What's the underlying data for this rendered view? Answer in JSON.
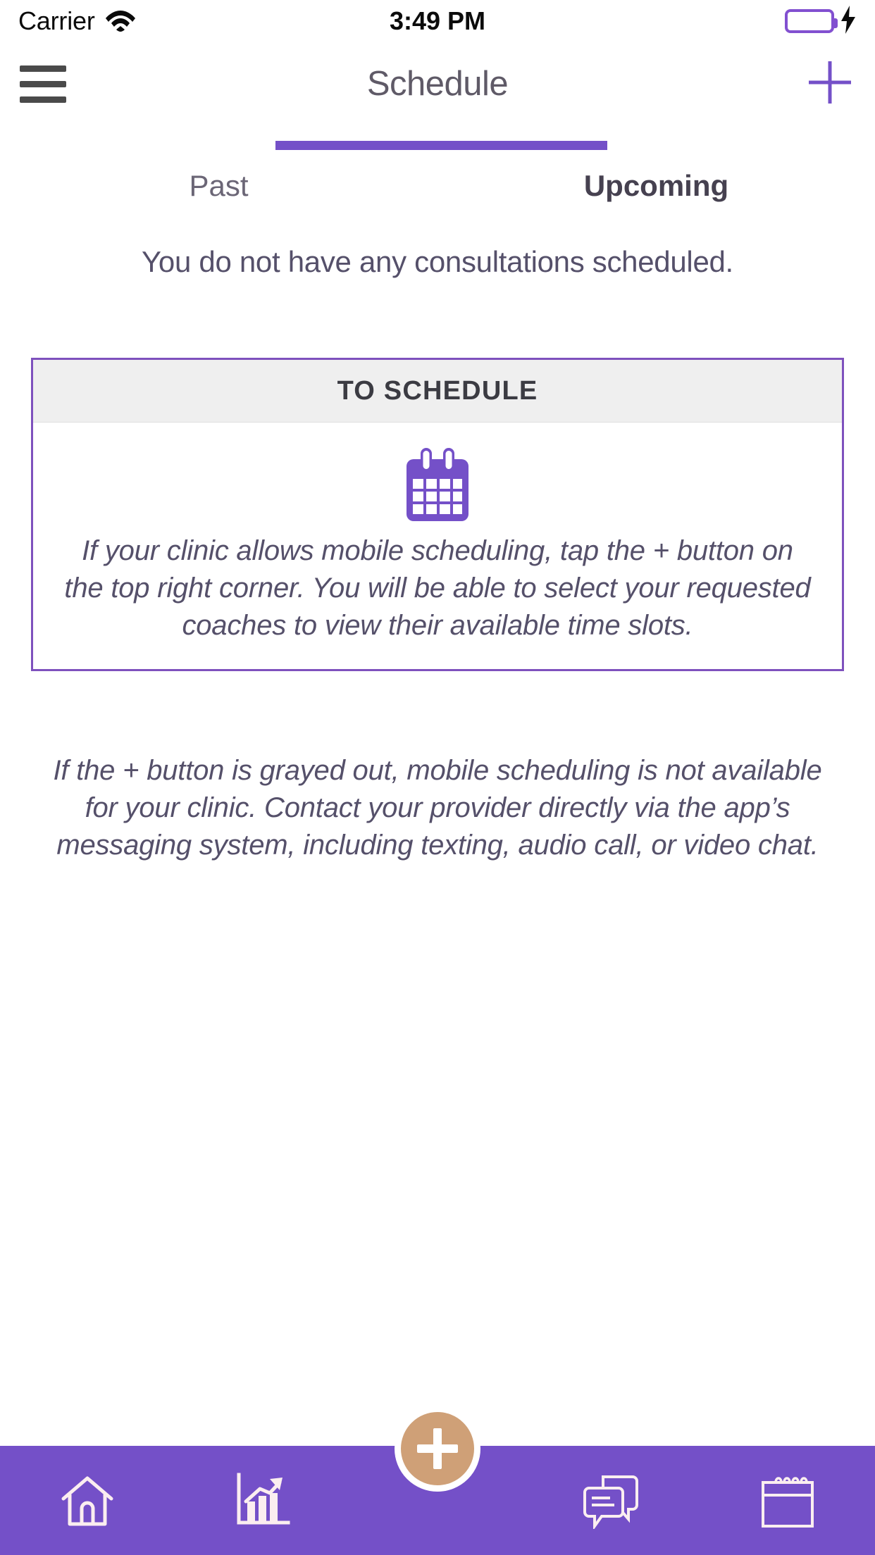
{
  "status_bar": {
    "carrier": "Carrier",
    "time": "3:49 PM",
    "wifi_icon": "wifi-icon",
    "battery_icon": "battery-icon",
    "charging_icon": "lightning-bolt-icon",
    "battery_color": "#3ed754",
    "battery_outline_color": "#8250d0"
  },
  "nav": {
    "menu_icon": "hamburger-menu-icon",
    "title": "Schedule",
    "add_icon": "plus-icon",
    "add_icon_color": "#7450c8",
    "title_color": "#5f5a67"
  },
  "tabs": {
    "indicator_color": "#7450c8",
    "items": [
      {
        "label": "Past",
        "active": false
      },
      {
        "label": "Upcoming",
        "active": true
      }
    ]
  },
  "main": {
    "empty_message": "You do not have any consultations scheduled.",
    "card": {
      "header_title": "TO SCHEDULE",
      "header_bg": "#efefef",
      "border_color": "#7e51bd",
      "icon": "calendar-icon",
      "icon_color": "#7450c8",
      "body_text": "If your clinic allows mobile scheduling, tap the + button on the top right corner. You will be able to select your requested coaches to view their available time slots."
    },
    "note": "If the + button is grayed out, mobile scheduling is not available for your clinic. Contact your provider directly via the app’s messaging system, including texting, audio call, or video chat."
  },
  "bottom_bar": {
    "background": "#7450c8",
    "icon_color": "#fbeef0",
    "items": [
      {
        "icon": "home-icon",
        "name": "home"
      },
      {
        "icon": "bar-chart-trend-icon",
        "name": "progress"
      },
      {
        "icon": "chat-bubbles-icon",
        "name": "messages"
      },
      {
        "icon": "notepad-calendar-icon",
        "name": "schedule"
      }
    ],
    "fab": {
      "icon": "plus-icon",
      "background": "#cfa077",
      "ring_color": "#ffffff"
    }
  }
}
